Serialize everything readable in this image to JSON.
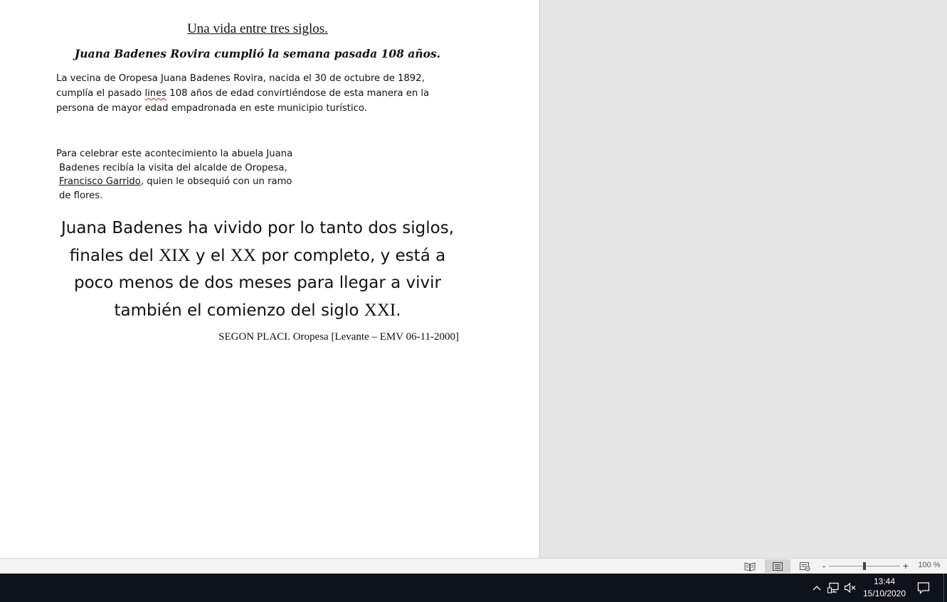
{
  "document": {
    "title": "Una vida entre tres siglos.",
    "subtitle": "Juana Badenes Rovira cumplió la semana pasada 108 años.",
    "para1": {
      "before": "La vecina de Oropesa Juana Badenes Rovira, nacida el 30 de octubre de 1892, cumplía el pasado ",
      "misspelled": "lines",
      "after": " 108 años de edad convirtiéndose de esta manera en la persona de mayor edad empadronada en este municipio turístico."
    },
    "para2": {
      "line1": "Para celebrar este acontecimiento la abuela Juana",
      "line2": "Badenes recibía la visita del alcalde de Oropesa,",
      "link": "Francisco Garrido",
      "line3_after": ", quien le obsequió con un ramo",
      "line4": "de flores."
    },
    "quote": {
      "part1": "Juana Badenes ha vivido por lo tanto dos siglos, finales del ",
      "roman1": "XIX",
      "part2": " y el ",
      "roman2": "XX",
      "part3": " por completo, y está a poco menos de dos meses para llegar a vivir también el comienzo del siglo ",
      "roman3": "XXI",
      "part4": "."
    },
    "source": "SEGON PLACI. Oropesa [Levante – EMV 06-11-2000]"
  },
  "status_bar": {
    "zoom_level": "100 %",
    "zoom_minus": "-",
    "zoom_plus": "+",
    "zoom_fraction": 0.5,
    "active_view": "print-layout"
  },
  "taskbar": {
    "time": "13:44",
    "date": "15/10/2020",
    "tray_icons": [
      "chevron-up-icon",
      "network-icon",
      "volume-muted-icon",
      "notifications-icon"
    ]
  }
}
